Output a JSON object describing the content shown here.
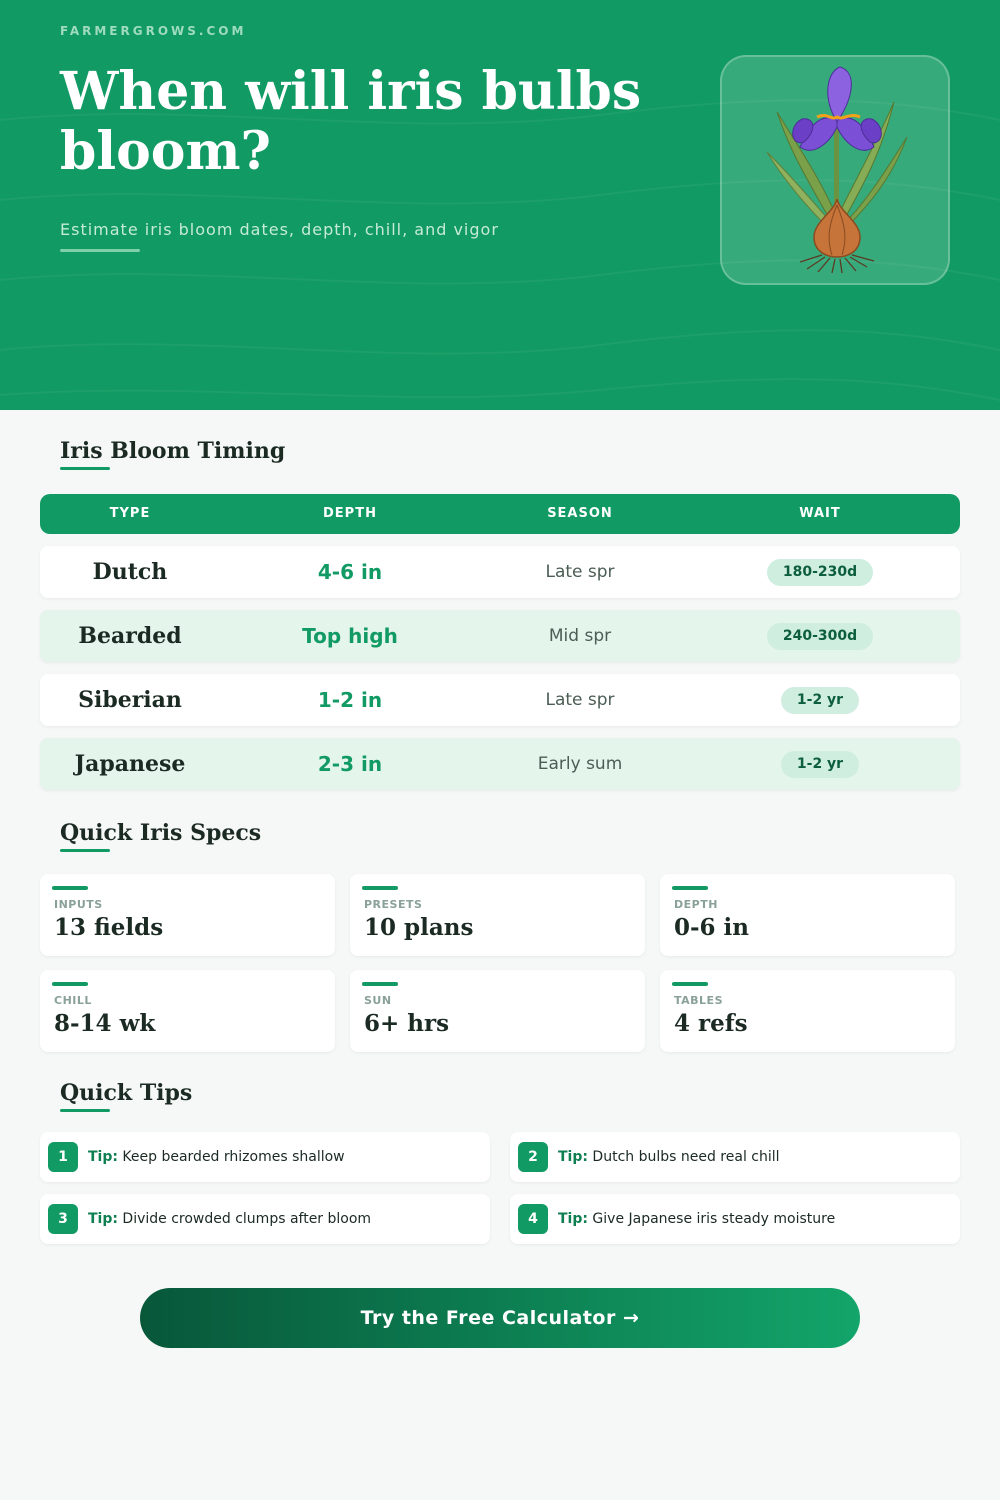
{
  "header": {
    "site_name": "FARMERGROWS.COM",
    "title": "When will iris bulbs bloom?",
    "subtitle": "Estimate iris bloom dates, depth, chill, and vigor",
    "image_icon": "iris-bulb-illustration"
  },
  "timing": {
    "title": "Iris Bloom Timing",
    "columns": [
      "TYPE",
      "DEPTH",
      "SEASON",
      "WAIT"
    ],
    "rows": [
      {
        "type": "Dutch",
        "depth": "4-6 in",
        "season": "Late spr",
        "wait": "180-230d"
      },
      {
        "type": "Bearded",
        "depth": "Top high",
        "season": "Mid spr",
        "wait": "240-300d"
      },
      {
        "type": "Siberian",
        "depth": "1-2 in",
        "season": "Late spr",
        "wait": "1-2 yr"
      },
      {
        "type": "Japanese",
        "depth": "2-3 in",
        "season": "Early sum",
        "wait": "1-2 yr"
      }
    ]
  },
  "specs": {
    "title": "Quick Iris Specs",
    "items": [
      {
        "label": "INPUTS",
        "value": "13 fields"
      },
      {
        "label": "PRESETS",
        "value": "10 plans"
      },
      {
        "label": "DEPTH",
        "value": "0-6 in"
      },
      {
        "label": "CHILL",
        "value": "8-14 wk"
      },
      {
        "label": "SUN",
        "value": "6+ hrs"
      },
      {
        "label": "TABLES",
        "value": "4 refs"
      }
    ]
  },
  "tips": {
    "title": "Quick Tips",
    "prefix": "Tip:",
    "items": [
      {
        "num": "1",
        "text": "Keep bearded rhizomes shallow"
      },
      {
        "num": "2",
        "text": "Dutch bulbs need real chill"
      },
      {
        "num": "3",
        "text": "Divide crowded clumps after bloom"
      },
      {
        "num": "4",
        "text": "Give Japanese iris steady moisture"
      }
    ]
  },
  "cta": {
    "label": "Try the Free Calculator →"
  },
  "colors": {
    "brand_green": "#119a63",
    "row_alt": "#e4f5ec",
    "pill_bg": "#cfeee0",
    "pill_text": "#0d5e3d"
  }
}
